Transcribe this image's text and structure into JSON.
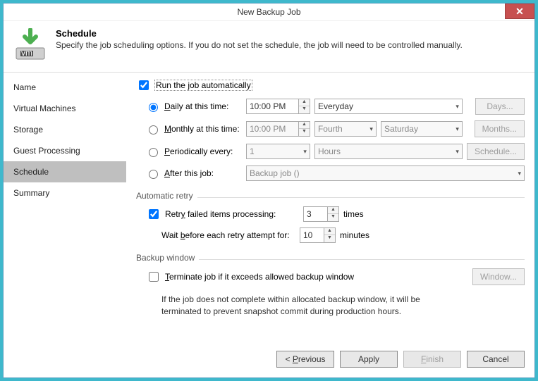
{
  "title": "New Backup Job",
  "header": {
    "title": "Schedule",
    "subtitle": "Specify the job scheduling options. If you do not set the schedule, the job will need to be controlled manually."
  },
  "sidebar": {
    "items": [
      {
        "label": "Name"
      },
      {
        "label": "Virtual Machines"
      },
      {
        "label": "Storage"
      },
      {
        "label": "Guest Processing"
      },
      {
        "label": "Schedule"
      },
      {
        "label": "Summary"
      }
    ]
  },
  "run_auto": {
    "label": "Run the job automatically"
  },
  "daily": {
    "label": "Daily at this time:",
    "time": "10:00 PM",
    "freq": "Everyday",
    "days_btn": "Days..."
  },
  "monthly": {
    "label": "Monthly at this time:",
    "time": "10:00 PM",
    "ord": "Fourth",
    "day": "Saturday",
    "months_btn": "Months..."
  },
  "periodic": {
    "label": "Periodically every:",
    "val": "1",
    "unit": "Hours",
    "sched_btn": "Schedule..."
  },
  "after": {
    "label": "After this job:",
    "val": "Backup job ()"
  },
  "retry": {
    "group": "Automatic retry",
    "label": "Retry failed items processing:",
    "count": "3",
    "times": "times",
    "wait_label": "Wait before each retry attempt for:",
    "wait_val": "10",
    "minutes": "minutes"
  },
  "window": {
    "group": "Backup window",
    "label": "Terminate job if it exceeds allowed backup window",
    "btn": "Window...",
    "hint": "If the job does not complete within allocated backup window, it will be terminated to prevent snapshot commit during production hours."
  },
  "footer": {
    "prev": "< Previous",
    "apply": "Apply",
    "finish": "Finish",
    "cancel": "Cancel"
  }
}
